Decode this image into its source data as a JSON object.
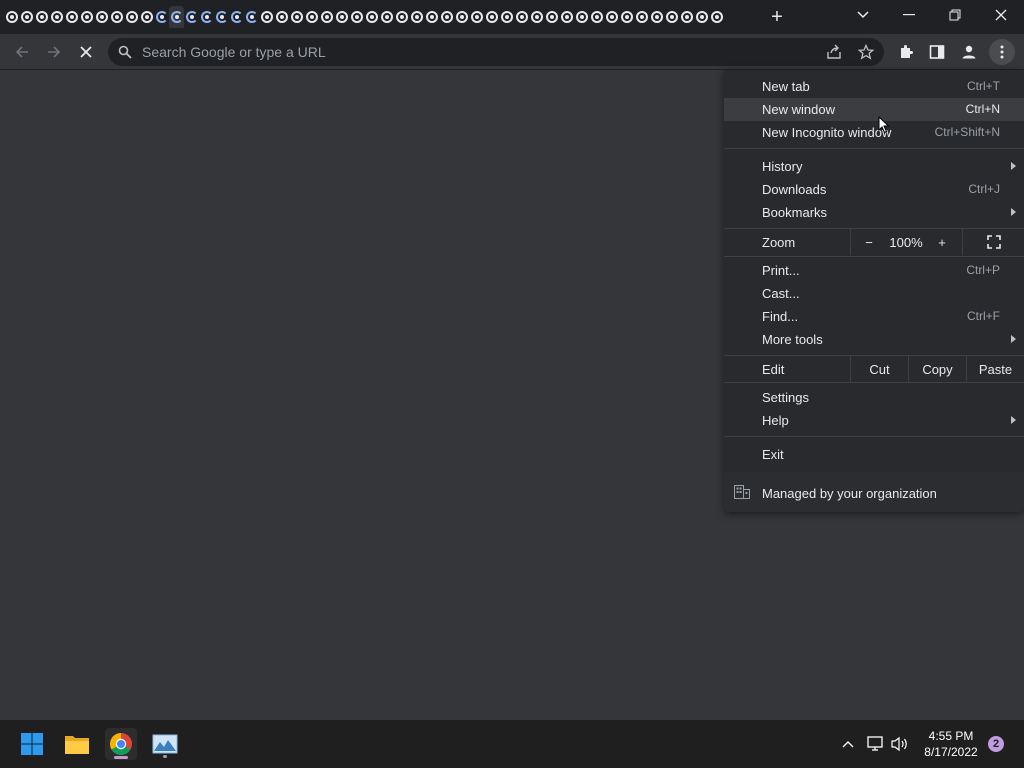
{
  "tabstrip": {
    "tab_count": 48,
    "active_tab_index": 11,
    "loading_tabs": [
      10,
      11,
      12,
      13,
      14,
      15,
      16
    ]
  },
  "toolbar": {
    "omnibox_placeholder": "Search Google or type a URL"
  },
  "menu": {
    "new_tab": {
      "label": "New tab",
      "shortcut": "Ctrl+T"
    },
    "new_window": {
      "label": "New window",
      "shortcut": "Ctrl+N"
    },
    "new_incognito": {
      "label": "New Incognito window",
      "shortcut": "Ctrl+Shift+N"
    },
    "history": {
      "label": "History"
    },
    "downloads": {
      "label": "Downloads",
      "shortcut": "Ctrl+J"
    },
    "bookmarks": {
      "label": "Bookmarks"
    },
    "zoom": {
      "label": "Zoom",
      "minus": "−",
      "value": "100%",
      "plus": "+"
    },
    "print": {
      "label": "Print...",
      "shortcut": "Ctrl+P"
    },
    "cast": {
      "label": "Cast..."
    },
    "find": {
      "label": "Find...",
      "shortcut": "Ctrl+F"
    },
    "more_tools": {
      "label": "More tools"
    },
    "edit": {
      "label": "Edit",
      "cut": "Cut",
      "copy": "Copy",
      "paste": "Paste"
    },
    "settings": {
      "label": "Settings"
    },
    "help": {
      "label": "Help"
    },
    "exit": {
      "label": "Exit"
    },
    "managed": {
      "label": "Managed by your organization"
    }
  },
  "taskbar": {
    "time": "4:55 PM",
    "date": "8/17/2022",
    "notification_count": "2",
    "apps": [
      "windows-start-icon",
      "file-explorer-icon",
      "chrome-icon",
      "image-app-icon"
    ]
  },
  "colors": {
    "menu_bg": "#292a2d",
    "highlight": "#3c3d40",
    "page_bg": "#35363a",
    "taskbar_bg": "#1f1f1f"
  }
}
